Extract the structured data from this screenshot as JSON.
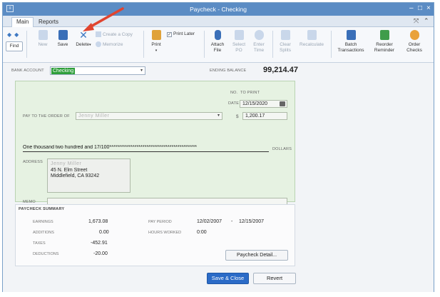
{
  "window": {
    "title": "Paycheck - Checking",
    "tabs": [
      "Main",
      "Reports"
    ]
  },
  "toolbar": {
    "find": "Find",
    "new": "New",
    "save": "Save",
    "delete": "Delete",
    "create_copy": "Create a Copy",
    "memorize": "Memorize",
    "print": "Print",
    "print_later": "Print Later",
    "attach_file": [
      "Attach",
      "File"
    ],
    "select_po": [
      "Select",
      "PO"
    ],
    "enter_time": [
      "Enter",
      "Time"
    ],
    "clear_splits": [
      "Clear",
      "Splits"
    ],
    "recalculate": "Recalculate",
    "batch_transactions": [
      "Batch",
      "Transactions"
    ],
    "reorder_reminder": [
      "Reorder",
      "Reminder"
    ],
    "order_checks": [
      "Order",
      "Checks"
    ]
  },
  "header": {
    "bank_account_label": "BANK ACCOUNT",
    "bank_account_value": "Checking",
    "ending_balance_label": "ENDING BALANCE",
    "ending_balance_value": "99,214.47"
  },
  "check": {
    "no_label": "NO.",
    "no_value": "TO PRINT",
    "date_label": "DATE",
    "date_value": "12/15/2020",
    "pay_to_label": "PAY TO THE ORDER OF",
    "pay_to_value": "Jenny Miller",
    "amount_symbol": "$",
    "amount_value": "1,200.17",
    "amount_words": "One thousand two hundred and 17/100*********************************************",
    "dollars_label": "DOLLARS",
    "address_label": "ADDRESS",
    "address_lines": [
      "Jenny Miller",
      "45 N. Elm Street",
      "Middlefield, CA 93242"
    ],
    "memo_label": "MEMO"
  },
  "summary": {
    "title": "PAYCHECK SUMMARY",
    "earnings_label": "EARNINGS",
    "earnings_value": "1,673.08",
    "additions_label": "ADDITIONS",
    "additions_value": "0.00",
    "taxes_label": "TAXES",
    "taxes_value": "-452.91",
    "deductions_label": "DEDUCTIONS",
    "deductions_value": "-20.00",
    "pay_period_label": "PAY PERIOD",
    "pay_period_start": "12/02/2007",
    "pay_period_dash": "-",
    "pay_period_end": "12/15/2007",
    "hours_worked_label": "HOURS WORKED",
    "hours_worked_value": "0:00",
    "detail_button": "Paycheck Detail..."
  },
  "footer": {
    "save_close": "Save & Close",
    "revert": "Revert"
  },
  "colors": {
    "titlebar": "#5b8cc4",
    "account_highlight": "#2e9e3a",
    "check_background": "#e6f2e2",
    "primary_button": "#2b6bc7",
    "annotation_arrow": "#e0442f"
  }
}
